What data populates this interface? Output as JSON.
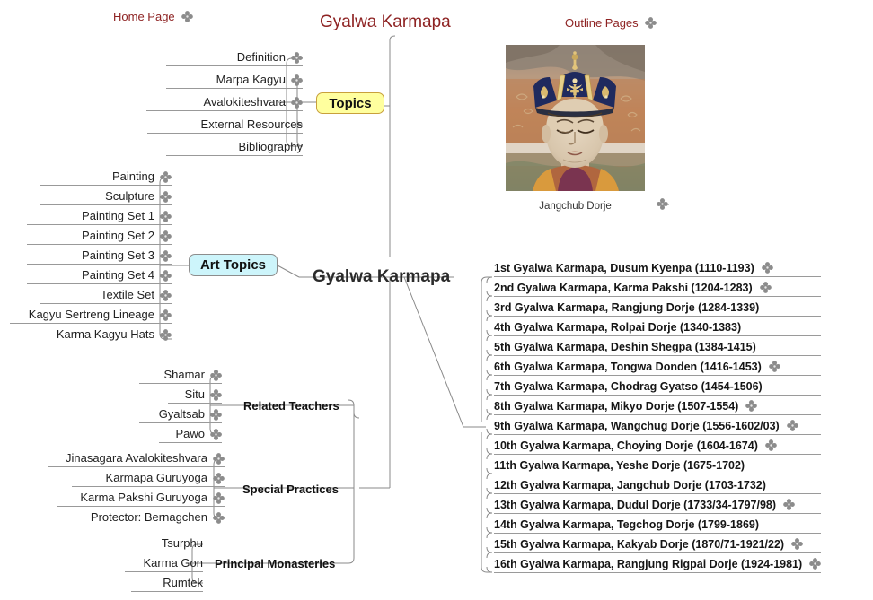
{
  "header": {
    "home_link": "Home Page",
    "title": "Gyalwa Karmapa",
    "outline_link": "Outline Pages"
  },
  "root": {
    "label": "Gyalwa Karmapa"
  },
  "image_node": {
    "caption": "Jangchub Dorje",
    "alt": "Thangka portrait of Jangchub Dorje wearing the black crown"
  },
  "branches": {
    "topics": {
      "label": "Topics",
      "fill": "#ffff9e",
      "border": "#c8a03c",
      "items": [
        {
          "label": "Definition",
          "icon": "clover-icon"
        },
        {
          "label": "Marpa Kagyu",
          "icon": "clover-icon"
        },
        {
          "label": "Avalokiteshvara",
          "icon": "clover-icon"
        },
        {
          "label": "External Resources",
          "icon": ""
        },
        {
          "label": "Bibliography",
          "icon": ""
        }
      ]
    },
    "art_topics": {
      "label": "Art Topics",
      "fill": "#cdf5fb",
      "border": "#8d8d8d",
      "items": [
        {
          "label": "Painting",
          "icon": "clover-icon"
        },
        {
          "label": "Sculpture",
          "icon": "clover-icon"
        },
        {
          "label": "Painting Set 1",
          "icon": "clover-icon"
        },
        {
          "label": "Painting Set 2",
          "icon": "clover-icon"
        },
        {
          "label": "Painting Set 3",
          "icon": "clover-icon"
        },
        {
          "label": "Painting Set 4",
          "icon": "clover-icon"
        },
        {
          "label": "Textile Set",
          "icon": "clover-icon"
        },
        {
          "label": "Kagyu Sertreng Lineage",
          "icon": "clover-icon"
        },
        {
          "label": "Karma Kagyu Hats",
          "icon": "clover-icon"
        }
      ]
    },
    "related_teachers": {
      "label": "Related Teachers",
      "items": [
        {
          "label": "Shamar",
          "icon": "clover-icon"
        },
        {
          "label": "Situ",
          "icon": "clover-icon"
        },
        {
          "label": "Gyaltsab",
          "icon": "clover-icon"
        },
        {
          "label": "Pawo",
          "icon": "clover-icon"
        }
      ]
    },
    "special_practices": {
      "label": "Special Practices",
      "items": [
        {
          "label": "Jinasagara Avalokiteshvara",
          "icon": "clover-icon"
        },
        {
          "label": "Karmapa Guruyoga",
          "icon": "clover-icon"
        },
        {
          "label": "Karma Pakshi Guruyoga",
          "icon": "clover-icon"
        },
        {
          "label": "Protector: Bernagchen",
          "icon": "clover-icon"
        }
      ]
    },
    "principal_monasteries": {
      "label": "Principal Monasteries",
      "items": [
        {
          "label": "Tsurphu",
          "icon": ""
        },
        {
          "label": "Karma Gon",
          "icon": ""
        },
        {
          "label": "Rumtek",
          "icon": ""
        }
      ]
    },
    "karmapas": {
      "items": [
        {
          "label": "1st Gyalwa Karmapa, Dusum Kyenpa (1110-1193)",
          "icon": "clover-icon"
        },
        {
          "label": "2nd Gyalwa Karmapa, Karma Pakshi (1204-1283)",
          "icon": "clover-icon"
        },
        {
          "label": "3rd Gyalwa Karmapa, Rangjung Dorje (1284-1339)",
          "icon": ""
        },
        {
          "label": "4th Gyalwa Karmapa, Rolpai Dorje (1340-1383)",
          "icon": ""
        },
        {
          "label": "5th Gyalwa Karmapa, Deshin Shegpa (1384-1415)",
          "icon": ""
        },
        {
          "label": "6th Gyalwa Karmapa, Tongwa Donden (1416-1453)",
          "icon": "clover-icon"
        },
        {
          "label": "7th Gyalwa Karmapa, Chodrag Gyatso (1454-1506)",
          "icon": ""
        },
        {
          "label": "8th Gyalwa Karmapa, Mikyo Dorje (1507-1554)",
          "icon": "clover-icon"
        },
        {
          "label": "9th Gyalwa Karmapa, Wangchug Dorje (1556-1602/03)",
          "icon": "clover-icon"
        },
        {
          "label": "10th Gyalwa Karmapa, Choying Dorje (1604-1674)",
          "icon": "clover-icon"
        },
        {
          "label": "11th Gyalwa Karmapa, Yeshe Dorje (1675-1702)",
          "icon": ""
        },
        {
          "label": "12th Gyalwa Karmapa, Jangchub Dorje (1703-1732)",
          "icon": ""
        },
        {
          "label": "13th Gyalwa Karmapa, Dudul Dorje (1733/34-1797/98)",
          "icon": "clover-icon"
        },
        {
          "label": "14th Gyalwa Karmapa, Tegchog Dorje (1799-1869)",
          "icon": ""
        },
        {
          "label": "15th Gyalwa Karmapa, Kakyab Dorje (1870/71-1921/22)",
          "icon": "clover-icon"
        },
        {
          "label": "16th Gyalwa Karmapa, Rangjung Rigpai Dorje (1924-1981)",
          "icon": "clover-icon"
        }
      ]
    }
  },
  "colors": {
    "link_text": "#8e2323",
    "title": "#8e2323",
    "wire": "#8a8a8a",
    "leaf_rule": "#999999",
    "icon": "#8c8c8c"
  }
}
